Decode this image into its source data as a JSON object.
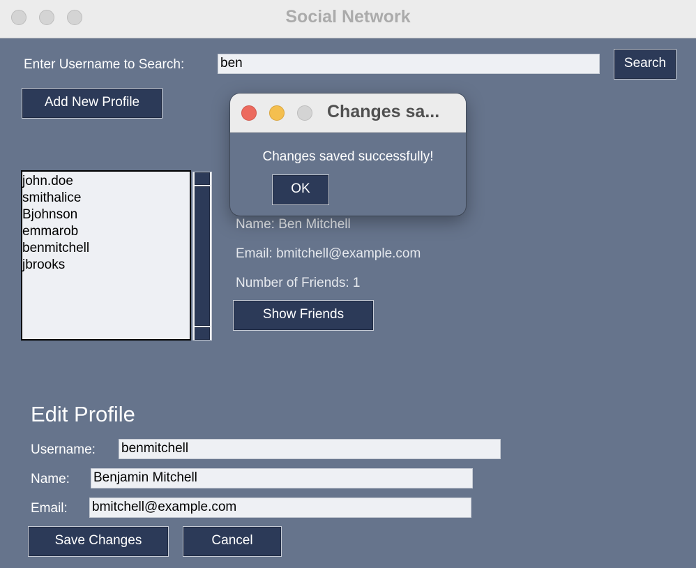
{
  "window": {
    "title": "Social Network"
  },
  "search": {
    "label": "Enter Username to Search:",
    "value": "ben",
    "button_label": "Search"
  },
  "add_profile_button": "Add New Profile",
  "profiles": [
    "john.doe",
    "smithalice",
    "Bjohnson",
    "emmarob",
    "benmitchell",
    "jbrooks"
  ],
  "details": {
    "name": "Name: Ben Mitchell",
    "email": "Email: bmitchell@example.com",
    "friends": "Number of Friends: 1",
    "show_friends_button": "Show Friends"
  },
  "edit_profile": {
    "heading": "Edit Profile",
    "username_label": "Username:",
    "username_value": "benmitchell",
    "name_label": "Name:",
    "name_value": "Benjamin Mitchell",
    "email_label": "Email:",
    "email_value": "bmitchell@example.com",
    "save_button": "Save Changes",
    "cancel_button": "Cancel"
  },
  "dialog": {
    "title": "Changes sa...",
    "message": "Changes saved successfully!",
    "ok_button": "OK"
  },
  "colors": {
    "window_bg": "#66748c",
    "button_bg": "#2c3a58",
    "entry_bg": "#eef0f4",
    "close_red": "#ec6a5e",
    "minimize_yellow": "#f4bf4f"
  }
}
